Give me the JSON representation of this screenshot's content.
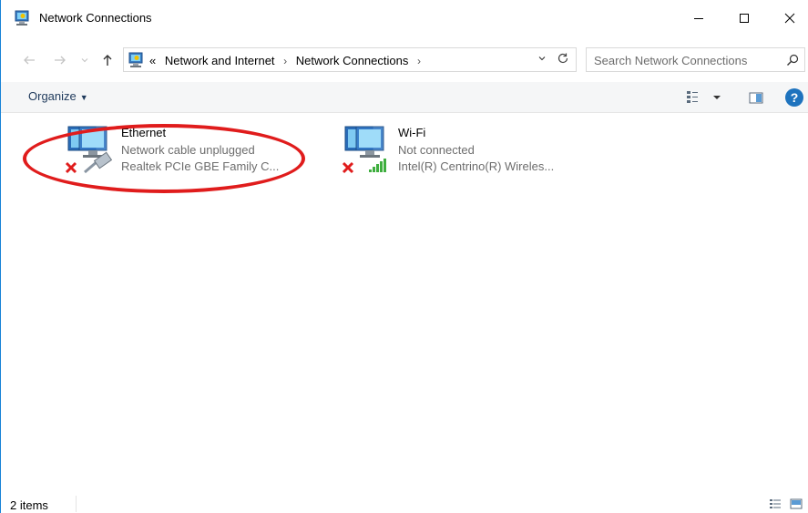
{
  "window": {
    "title": "Network Connections",
    "title_icon": "network-connections-icon",
    "buttons": {
      "minimize_icon": "minimize-icon",
      "maximize_icon": "maximize-icon",
      "close_icon": "close-icon"
    }
  },
  "nav": {
    "back_icon": "back-arrow-icon",
    "forward_icon": "forward-arrow-icon",
    "recent_icon": "chevron-down-icon",
    "up_icon": "up-arrow-icon",
    "address": {
      "overflow": "«",
      "crumbs": [
        "Network and Internet",
        "Network Connections"
      ],
      "separator": "›"
    },
    "search": {
      "placeholder": "Search Network Connections",
      "value": ""
    }
  },
  "commandbar": {
    "organize_label": "Organize",
    "change_view_icon": "change-view-icon",
    "preview_pane_icon": "preview-pane-icon",
    "help_label": "?"
  },
  "items": [
    {
      "name": "Ethernet",
      "status": "Network cable unplugged",
      "device": "Realtek PCIe GBE Family C...",
      "icon": "ethernet-adapter-icon",
      "state_icon": "disconnected-x-icon"
    },
    {
      "name": "Wi-Fi",
      "status": "Not connected",
      "device": "Intel(R) Centrino(R) Wireles...",
      "icon": "wifi-adapter-icon",
      "state_icon": "disconnected-x-icon"
    }
  ],
  "annotation": {
    "color": "#e01c1c"
  },
  "statusbar": {
    "count": "2 items"
  },
  "colors": {
    "accent": "#1883d7",
    "organize_text": "#1e395b",
    "secondary_text": "#6d6d6d",
    "error_red": "#e01c1c"
  }
}
